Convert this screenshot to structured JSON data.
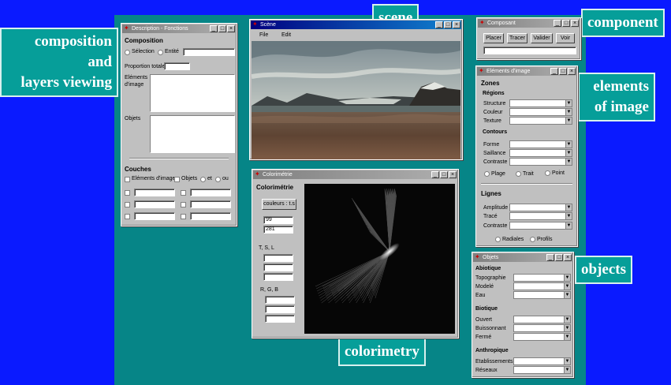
{
  "callouts": {
    "composition": [
      "composition",
      "and",
      "layers viewing"
    ],
    "scene": "scene",
    "component": "component",
    "elements": [
      "elements",
      "of image"
    ],
    "objects": "objects",
    "colorimetry": "colorimetry"
  },
  "desc": {
    "title": "Description - Fonctions",
    "composition": "Composition",
    "selection": "Sélection",
    "entite": "Entité",
    "proportion": "Proportion totale",
    "elements_label": [
      "Eléments",
      "d'image"
    ],
    "objets_label": "Objets",
    "couches": "Couches",
    "couche_elements": "Eléments d'image",
    "couche_objets": "Objets",
    "et": "et",
    "ou": "ou"
  },
  "scene": {
    "title": "Scène",
    "menu_file": "File",
    "menu_edit": "Edit"
  },
  "composant": {
    "title": "Composant",
    "placer": "Placer",
    "tracer": "Tracer",
    "valider": "Valider",
    "voir": "Voir"
  },
  "elements": {
    "title": "Eléments d'image",
    "zones": "Zones",
    "regions": "Régions",
    "structure": "Structure",
    "couleur": "Couleur",
    "texture": "Texture",
    "contours": "Contours",
    "forme": "Forme",
    "saillance": "Saillance",
    "contraste": "Contraste",
    "plage": "Plage",
    "trait": "Trait",
    "point": "Point",
    "lignes": "Lignes",
    "amplitude": "Amplitude",
    "trace": "Tracé",
    "contraste2": "Contraste",
    "radiales": "Radiales",
    "profils": "Profils"
  },
  "colorimetrie": {
    "title": "Colorimétrie",
    "heading": "Colorimétrie",
    "couleurs_btn": "couleurs : t.s",
    "val1": "99",
    "val2": "281",
    "tsl": "T, S, L",
    "rgb": "R, G, B"
  },
  "objets": {
    "title": "Objets",
    "abiotique": "Abiotique",
    "topographie": "Topographie",
    "modele": "Modelé",
    "eau": "Eau",
    "biotique": "Biotique",
    "ouvert": "Ouvert",
    "buissonnant": "Buissonnant",
    "ferme": "Fermé",
    "anthropique": "Anthropique",
    "etablissements": "Etablissements",
    "reseaux": "Réseaux"
  },
  "window_buttons": {
    "minimize": "_",
    "maximize": "□",
    "close": "×"
  },
  "colors": {
    "desktop": "#068587",
    "background": "#0a1aff",
    "callout": "#069e99",
    "titlebar_active": "#000080"
  }
}
